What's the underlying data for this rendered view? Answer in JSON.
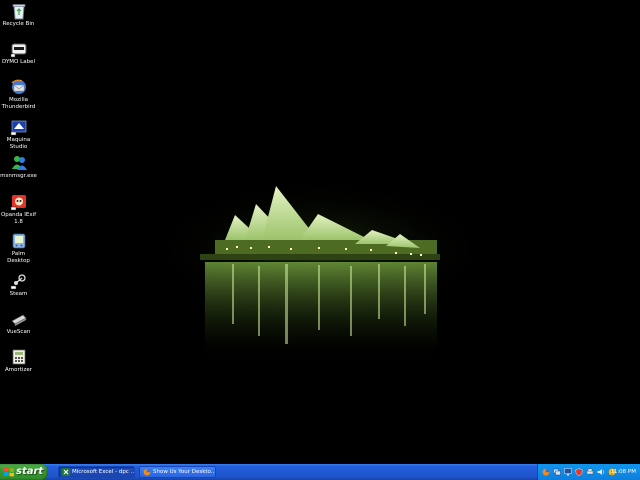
{
  "desktop": {
    "icons": [
      {
        "label": "Recycle Bin",
        "icon": "recycle-bin-icon"
      },
      {
        "label": "DYMO Label",
        "icon": "dymo-label-icon"
      },
      {
        "label": "Mozilla\nThunderbird",
        "icon": "thunderbird-icon"
      },
      {
        "label": "Maquina\nStudio",
        "icon": "maquina-studio-icon"
      },
      {
        "label": "msnmsgr.exe",
        "icon": "msn-messenger-icon"
      },
      {
        "label": "Opanda IExif\n1.8",
        "icon": "opanda-iexif-icon"
      },
      {
        "label": "Palm Desktop",
        "icon": "palm-desktop-icon"
      },
      {
        "label": "Steam",
        "icon": "steam-icon"
      },
      {
        "label": "VueScan",
        "icon": "vuescan-icon"
      },
      {
        "label": "Amortizer",
        "icon": "amortizer-icon"
      }
    ]
  },
  "taskbar": {
    "start_label": "start",
    "tasks": [
      {
        "label": "Microsoft Excel - dpc ...",
        "icon": "excel-icon"
      },
      {
        "label": "Show Us Your Deskto...",
        "icon": "firefox-icon"
      }
    ],
    "tray_icons": [
      "firefox-tray-icon",
      "network-tray-icon",
      "monitor-tray-icon",
      "security-tray-icon",
      "printer-tray-icon",
      "volume-tray-icon",
      "update-tray-icon"
    ],
    "clock": "11:08 PM"
  },
  "colors": {
    "taskbar_blue": "#245edb",
    "start_green": "#3c9a37",
    "tray_blue": "#0e94ec",
    "wallpaper_green": "#c8e6a0"
  }
}
